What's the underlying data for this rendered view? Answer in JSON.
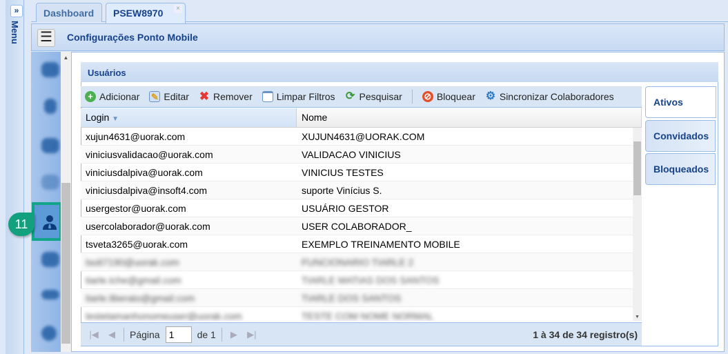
{
  "menu": {
    "label": "Menu",
    "toggle": "»"
  },
  "tabs": [
    {
      "label": "Dashboard"
    },
    {
      "label": "PSEW8970",
      "close": "×"
    }
  ],
  "header": {
    "title": "Configurações Ponto Mobile",
    "menu_icon": "☰"
  },
  "sidebar": {
    "badge": "11",
    "selected_icon": "user-tie-icon"
  },
  "panel": {
    "title": "Usuários"
  },
  "toolbar": [
    {
      "label": "Adicionar",
      "icon": "add-icon"
    },
    {
      "label": "Editar",
      "icon": "edit-icon"
    },
    {
      "label": "Remover",
      "icon": "remove-icon"
    },
    {
      "label": "Limpar Filtros",
      "icon": "clear-filter-icon"
    },
    {
      "label": "Pesquisar",
      "icon": "refresh-icon"
    },
    {
      "label": "Bloquear",
      "icon": "block-icon"
    },
    {
      "label": "Sincronizar Colaboradores",
      "icon": "sync-gear-icon"
    }
  ],
  "grid": {
    "columns": [
      "Login",
      "Nome"
    ],
    "rows": [
      [
        "xujun4631@uorak.com",
        "XUJUN4631@UORAK.COM"
      ],
      [
        "viniciusvalidacao@uorak.com",
        "VALIDACAO VINICIUS"
      ],
      [
        "viniciusdalpiva@uorak.com",
        "VINICIUS TESTES"
      ],
      [
        "viniciusdalpiva@insoft4.com",
        "suporte Vinícius S."
      ],
      [
        "usergestor@uorak.com",
        "USUÁRIO GESTOR"
      ],
      [
        "usercolaborador@uorak.com",
        "USER COLABORADOR_"
      ],
      [
        "tsveta3265@uorak.com",
        "EXEMPLO TREINAMENTO MOBILE"
      ],
      [
        "tsoli7190@uorak.com",
        "FUNCIONARIO TIARLE 2"
      ],
      [
        "tiarle.tche@gmail.com",
        "TIARLE MATIAS DOS SANTOS"
      ],
      [
        "tiarle.liberato@gmail.com",
        "TIARLE DOS SANTOS"
      ],
      [
        "testetamanhonomeuser@uorak.com",
        "TESTE COM NOME NORMAL"
      ]
    ],
    "blurred_from": 7
  },
  "pager": {
    "page_label": "Página",
    "page": "1",
    "of_label": "de 1",
    "info": "1 à 34 de 34 registro(s)"
  },
  "right_tabs": [
    {
      "label": "Ativos"
    },
    {
      "label": "Convidados"
    },
    {
      "label": "Bloqueados"
    }
  ]
}
